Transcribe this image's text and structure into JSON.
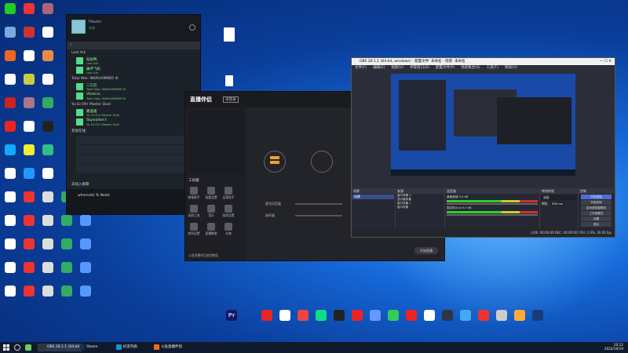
{
  "desktop": {
    "left_icons": [
      {
        "label": "微信",
        "color": "#2c2"
      },
      {
        "label": "",
        "color": "#e33"
      },
      {
        "label": "",
        "color": "#a67"
      },
      {
        "label": "",
        "color": "#7ad"
      },
      {
        "label": "",
        "color": "#c33"
      },
      {
        "label": "",
        "color": "#fff"
      },
      {
        "label": "",
        "color": "#e62"
      },
      {
        "label": "",
        "color": "#fff"
      },
      {
        "label": "",
        "color": "#e84"
      },
      {
        "label": "",
        "color": "#fff"
      },
      {
        "label": "",
        "color": "#cc4"
      },
      {
        "label": "",
        "color": "#fff"
      },
      {
        "label": "",
        "color": "#c22"
      },
      {
        "label": "",
        "color": "#a78"
      },
      {
        "label": "",
        "color": "#3a6"
      },
      {
        "label": "",
        "color": "#e22"
      },
      {
        "label": "",
        "color": "#fff"
      },
      {
        "label": "",
        "color": "#222"
      },
      {
        "label": "",
        "color": "#1af"
      },
      {
        "label": "",
        "color": "#ee3"
      },
      {
        "label": "",
        "color": "#3b8"
      },
      {
        "label": "",
        "color": "#fff"
      },
      {
        "label": "",
        "color": "#29f"
      },
      {
        "label": "",
        "color": "#fff"
      }
    ],
    "bottom_icons": [
      {
        "label": "Pr",
        "color": "#1b1464"
      },
      {
        "label": "",
        "color": "#e22"
      },
      {
        "label": "",
        "color": "#fff"
      },
      {
        "label": "",
        "color": "#e44"
      },
      {
        "label": "",
        "color": "#1d8"
      },
      {
        "label": "",
        "color": "#222"
      },
      {
        "label": "",
        "color": "#e22"
      },
      {
        "label": "",
        "color": "#69f"
      },
      {
        "label": "",
        "color": "#3c5"
      },
      {
        "label": "",
        "color": "#e22"
      },
      {
        "label": "",
        "color": "#fff"
      },
      {
        "label": "",
        "color": "#334"
      },
      {
        "label": "",
        "color": "#4ae"
      },
      {
        "label": "",
        "color": "#e33"
      },
      {
        "label": "",
        "color": "#ccc"
      },
      {
        "label": "",
        "color": "#fa3"
      },
      {
        "label": "",
        "color": "#1a3a7a"
      }
    ]
  },
  "steam": {
    "username": "Haven",
    "status": "在线",
    "groups": [
      {
        "name": "Lost Ark",
        "friends": [
          {
            "name": "韬韬鸭",
            "game": "Lost Ark"
          },
          {
            "name": "破坏飞机",
            "game": "Lost Ark"
          }
        ]
      },
      {
        "name": "Total War: WARHAMMER III",
        "friends": [
          {
            "name": "二口云",
            "game": "Total War: WARHAMMER III"
          },
          {
            "name": "Vitalicio",
            "game": "Total War: WARHAMMER III"
          }
        ]
      },
      {
        "name": "Yu-Gi-Oh! Master Duel",
        "friends": [
          {
            "name": "路遥遥",
            "game": "Yu-Gi-Oh! Master Duel"
          },
          {
            "name": "Skywalker.t",
            "game": "Yu-Gi-Oh! Master Duel"
          }
        ]
      }
    ],
    "online_header": "其他在线",
    "footer_header": "未加入群聊",
    "footer_item": "wheredisl % Nezik"
  },
  "stream_app": {
    "logo": "直播伴侣",
    "badge": "未登录",
    "tools_title": "工具箱",
    "tools": [
      "弹幕助手",
      "观看设置",
      "运营助手",
      "录屏工具",
      "音乐",
      "画质设置",
      "房间设置",
      "直播数据",
      "礼物"
    ],
    "bottom_link": "斗鱼直播伴侣使用教程",
    "start_button": "开始直播",
    "labels": [
      "麦克风音量",
      "扬声器"
    ]
  },
  "obs": {
    "title": "OBS 28.1.1 (64-bit, windows) - 配置文件: 未命名 - 场景: 未命名",
    "menu": [
      "文件(F)",
      "编辑(E)",
      "视图(V)",
      "停靠窗口(D)",
      "配置文件(P)",
      "场景集合(S)",
      "工具(T)",
      "帮助(H)"
    ],
    "docks": [
      "场景",
      "来源",
      "混音器",
      "转场特效",
      "控制"
    ],
    "scenes": [
      "场景"
    ],
    "sources": [
      "窗口采集 2",
      "显示器采集",
      "窗口采集 1",
      "窗口采集"
    ],
    "mixer": [
      {
        "name": "桌面音频",
        "level": "0.0 dB"
      },
      {
        "name": "麦克风/Aux",
        "level": "0.0 dB"
      }
    ],
    "transition": {
      "type": "淡出",
      "duration_label": "时长",
      "duration": "300 ms"
    },
    "controls": [
      "开始直播",
      "开始录制",
      "启动虚拟摄像机",
      "工作室模式",
      "设置",
      "退出"
    ],
    "status": "LIVE: 00:00:00    REC: 00:00:00    CPU: 2.6%, 30.00 fps"
  },
  "taskbar": {
    "items": [
      {
        "label": "OBS 28.1.1 (64-bit)",
        "active": true
      },
      {
        "label": "Steam",
        "active": false
      },
      {
        "label": "好友列表",
        "active": false
      },
      {
        "label": "斗鱼直播伴侣",
        "active": false
      }
    ],
    "time": "20:12",
    "date": "2022/10/19"
  }
}
